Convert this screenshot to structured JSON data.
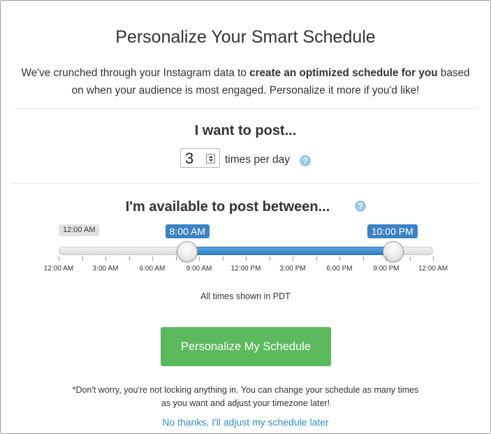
{
  "dialog": {
    "title": "Personalize Your Smart Schedule",
    "intro_part1": "We've crunched through your Instagram data to ",
    "intro_bold": "create an optimized schedule for you",
    "intro_part2": " based on when your audience is most engaged. Personalize it more if you'd like!"
  },
  "post_frequency": {
    "heading": "I want to post...",
    "value": "3",
    "unit_label": "times per day",
    "help_glyph": "?"
  },
  "availability": {
    "heading": "I'm available to post between...",
    "help_glyph": "?",
    "min_label": "12:00 AM",
    "start_label": "8:00 AM",
    "end_label": "10:00 PM",
    "start_fraction": 0.3333,
    "end_fraction": 0.9167,
    "tick_labels": [
      "12:00 AM",
      "3:00 AM",
      "6:00 AM",
      "9:00 AM",
      "12:00 PM",
      "3:00 PM",
      "6:00 PM",
      "9:00 PM",
      "12:00 AM"
    ],
    "timezone_note": "All times shown in PDT"
  },
  "actions": {
    "submit_label": "Personalize My Schedule",
    "disclaimer": "*Don't worry, you're not locking anything in. You can change your schedule as many times as you want and adjust your timezone later!",
    "skip_label": "No thanks, I'll adjust my schedule later"
  },
  "colors": {
    "accent_blue": "#3b82c4",
    "button_green": "#5cb85c",
    "link_blue": "#2a8fc9",
    "help_icon": "#9bc8e8"
  },
  "icons": {
    "help": "question-circle-icon",
    "spinner": "spinner-arrows-icon"
  }
}
